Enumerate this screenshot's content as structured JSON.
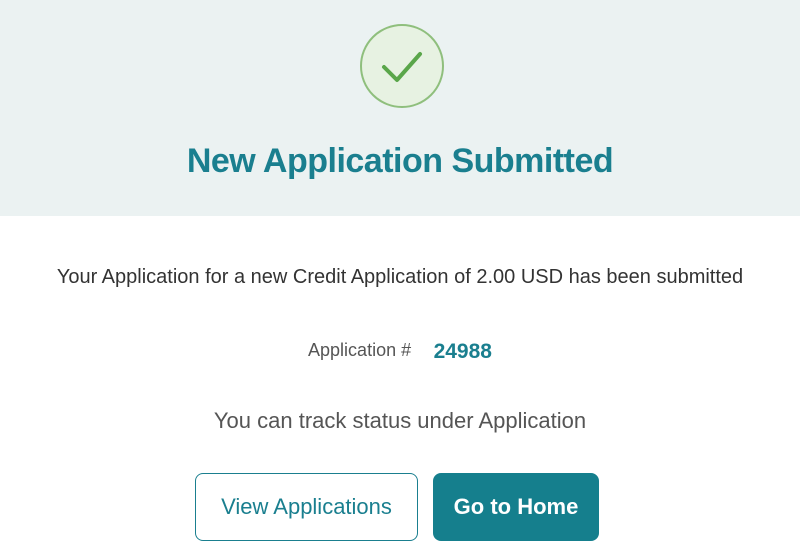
{
  "banner": {
    "icon": "check-circle-icon",
    "title": "New Application Submitted"
  },
  "message": "Your Application for a new Credit Application of 2.00 USD has been submitted",
  "application": {
    "label": "Application #",
    "number": "24988"
  },
  "track_text": "You can track status under Application",
  "buttons": {
    "view_applications": "View Applications",
    "go_home": "Go to Home"
  },
  "colors": {
    "accent": "#1a7f8f",
    "banner_bg": "#ebf2f2",
    "success_green": "#5aa64a"
  }
}
